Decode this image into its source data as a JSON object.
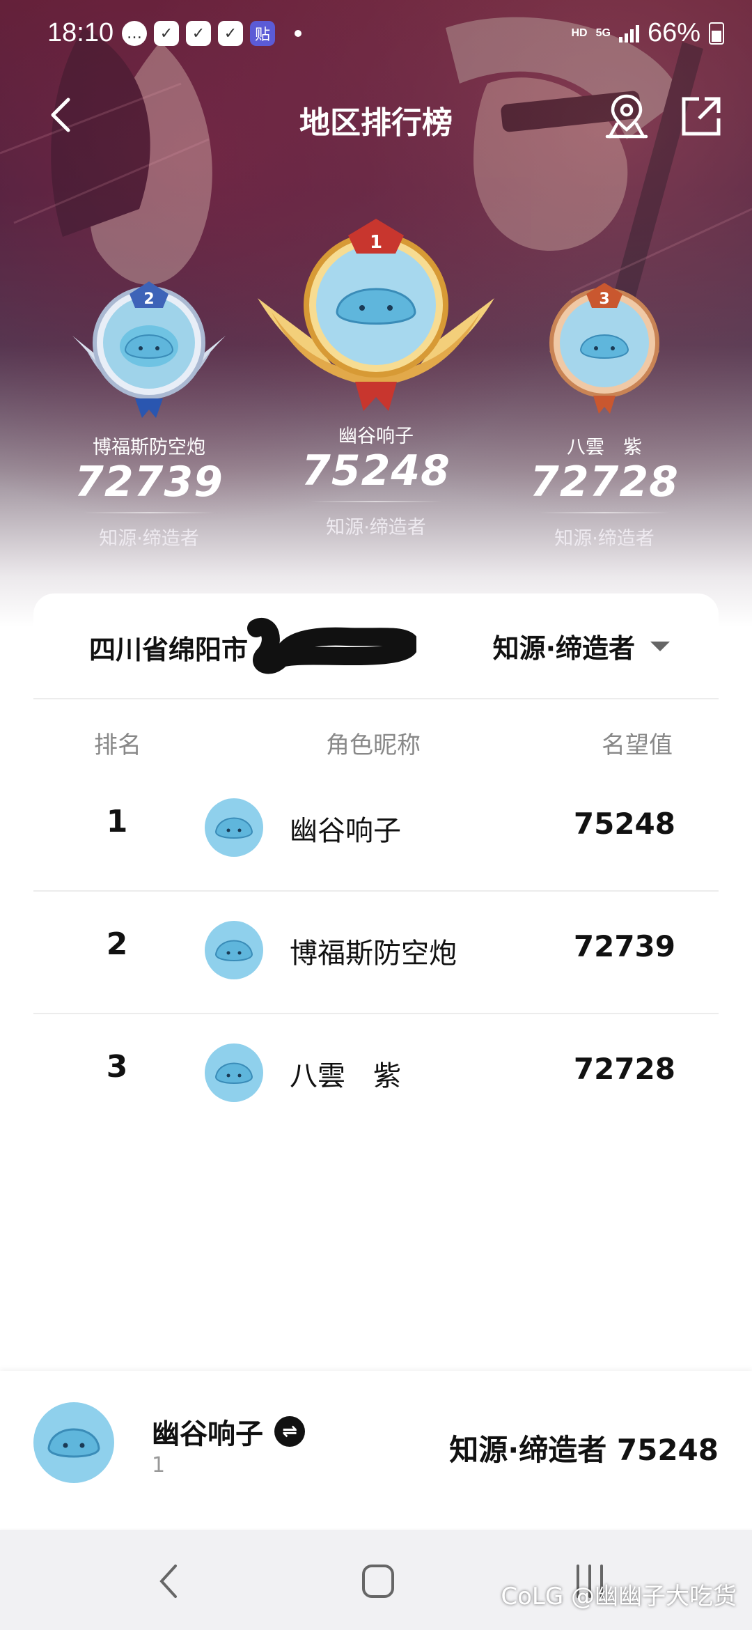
{
  "status_bar": {
    "time": "18:10",
    "network": "HD",
    "network_type": "5G",
    "battery": "66%"
  },
  "header": {
    "title": "地区排行榜",
    "back_icon": "chevron-left-icon",
    "location_icon": "map-pin-icon",
    "share_icon": "share-external-icon"
  },
  "podium": [
    {
      "rank": "2",
      "name": "博福斯防空炮",
      "score": "72739",
      "title": "知源·缔造者",
      "badge": "silver"
    },
    {
      "rank": "1",
      "name": "幽谷响子",
      "score": "75248",
      "title": "知源·缔造者",
      "badge": "gold"
    },
    {
      "rank": "3",
      "name": "八雲　紫",
      "score": "72728",
      "title": "知源·缔造者",
      "badge": "bronze"
    }
  ],
  "filters": {
    "region": "四川省绵阳市",
    "title_filter": "知源·缔造者"
  },
  "table": {
    "headers": {
      "rank": "排名",
      "name": "角色昵称",
      "score": "名望值"
    },
    "rows": [
      {
        "rank": "1",
        "name": "幽谷响子",
        "score": "75248"
      },
      {
        "rank": "2",
        "name": "博福斯防空炮",
        "score": "72739"
      },
      {
        "rank": "3",
        "name": "八雲　紫",
        "score": "72728"
      }
    ]
  },
  "me": {
    "name": "幽谷响子",
    "rank": "1",
    "title": "知源·缔造者",
    "score": "75248",
    "summary": "知源·缔造者 75248"
  },
  "watermark": "CoLG @幽幽子大吃货",
  "colors": {
    "hero_dark": "#5a1d33",
    "avatar_blue": "#7ccbe8",
    "gold": "#e8b24a",
    "silver": "#c9d3e3",
    "bronze": "#d89a6a",
    "nav_bg": "#f1f1f3"
  }
}
